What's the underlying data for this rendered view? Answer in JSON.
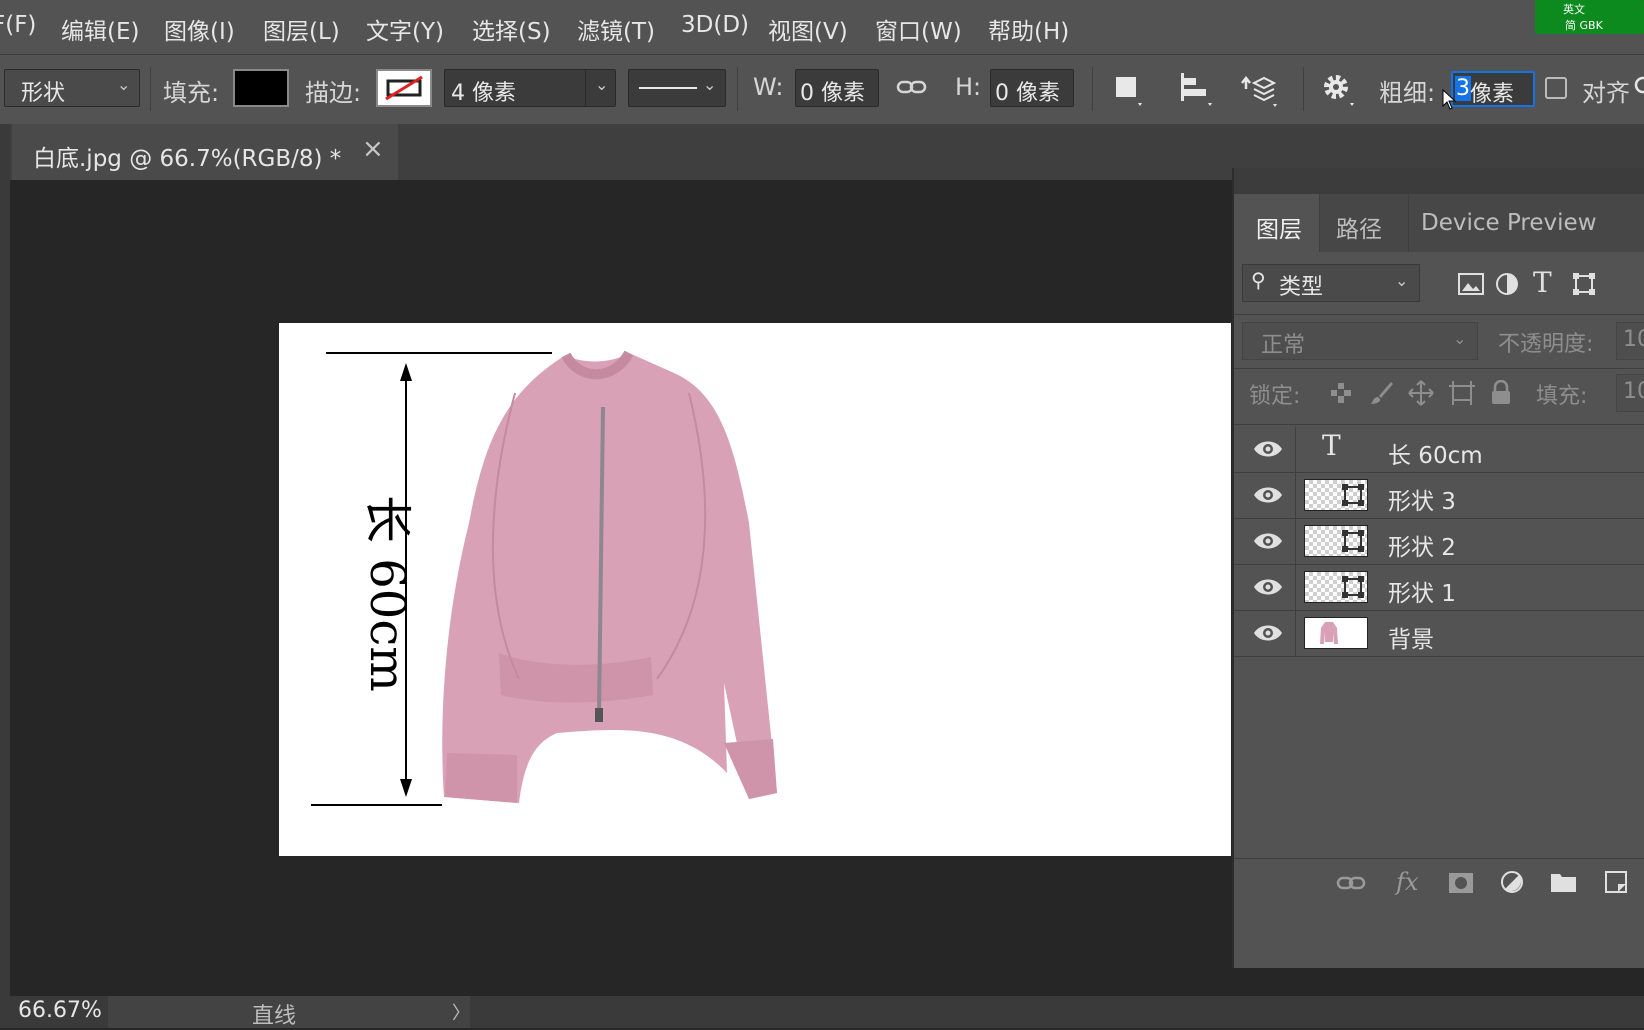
{
  "menu": {
    "items": [
      "F(F)",
      "编辑(E)",
      "图像(I)",
      "图层(L)",
      "文字(Y)",
      "选择(S)",
      "滤镜(T)",
      "3D(D)",
      "视图(V)",
      "窗口(W)",
      "帮助(H)"
    ],
    "ime_top": "英文",
    "ime_bottom": "简 GBK"
  },
  "options": {
    "mode_value": "形状",
    "fill_label": "填充:",
    "stroke_label": "描边:",
    "stroke_width": "4 像素",
    "w_label": "W:",
    "w_value": "0 像素",
    "h_label": "H:",
    "h_value": "0 像素",
    "weight_label": "粗细:",
    "weight_number": "3",
    "weight_unit": " 像素",
    "align_label": "对齐"
  },
  "document": {
    "tab_title": "白底.jpg @ 66.7%(RGB/8) *",
    "close_symbol": "×"
  },
  "artwork": {
    "measure_text": "长 60cm"
  },
  "layers_panel": {
    "tabs": [
      "图层",
      "路径",
      "Device Preview"
    ],
    "filter_value": "类型",
    "blend_mode": "正常",
    "opacity_label": "不透明度:",
    "opacity_value": "10",
    "lock_label": "锁定:",
    "fill_label": "填充:",
    "fill_value": "10",
    "layers": [
      {
        "name": "长 60cm",
        "kind": "text"
      },
      {
        "name": "形状 3",
        "kind": "shape"
      },
      {
        "name": "形状 2",
        "kind": "shape"
      },
      {
        "name": "形状 1",
        "kind": "shape"
      },
      {
        "name": "背景",
        "kind": "image"
      }
    ]
  },
  "status": {
    "zoom": "66.67%",
    "tool_info": "直线",
    "arrow": "〉"
  },
  "colors": {
    "fill_swatch": "#000000",
    "sweater": "#d9a1b6",
    "selection": "#1473e6"
  }
}
